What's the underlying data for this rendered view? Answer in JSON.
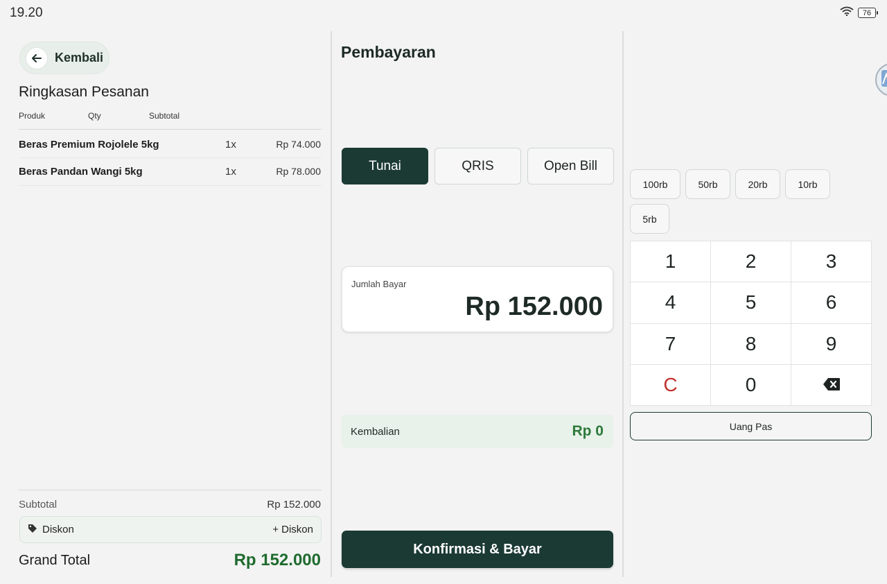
{
  "status_bar": {
    "time": "19.20",
    "battery": "76"
  },
  "left": {
    "back_label": "Kembali",
    "title": "Ringkasan Pesanan",
    "columns": {
      "product": "Produk",
      "qty": "Qty",
      "subtotal": "Subtotal"
    },
    "items": [
      {
        "name": "Beras Premium Rojolele 5kg",
        "qty": "1x",
        "subtotal": "Rp 74.000"
      },
      {
        "name": "Beras Pandan Wangi 5kg",
        "qty": "1x",
        "subtotal": "Rp 78.000"
      }
    ],
    "subtotal_label": "Subtotal",
    "subtotal_value": "Rp 152.000",
    "discount_label": "Diskon",
    "add_discount": "+ Diskon",
    "grand_total_label": "Grand Total",
    "grand_total_value": "Rp 152.000"
  },
  "middle": {
    "title": "Pembayaran",
    "methods": [
      "Tunai",
      "QRIS",
      "Open Bill"
    ],
    "active_method": "Tunai",
    "amount_label": "Jumlah Bayar",
    "amount_value": "Rp 152.000",
    "change_label": "Kembalian",
    "change_value": "Rp 0",
    "confirm_label": "Konfirmasi & Bayar"
  },
  "right": {
    "quick_amounts": [
      "100rb",
      "50rb",
      "20rb",
      "10rb",
      "5rb"
    ],
    "keys": [
      "1",
      "2",
      "3",
      "4",
      "5",
      "6",
      "7",
      "8",
      "9",
      "C",
      "0",
      "backspace"
    ],
    "exact_label": "Uang Pas"
  },
  "colors": {
    "primary": "#1b3a33",
    "accent_green": "#1f6b2e",
    "clear_red": "#c0302b"
  }
}
